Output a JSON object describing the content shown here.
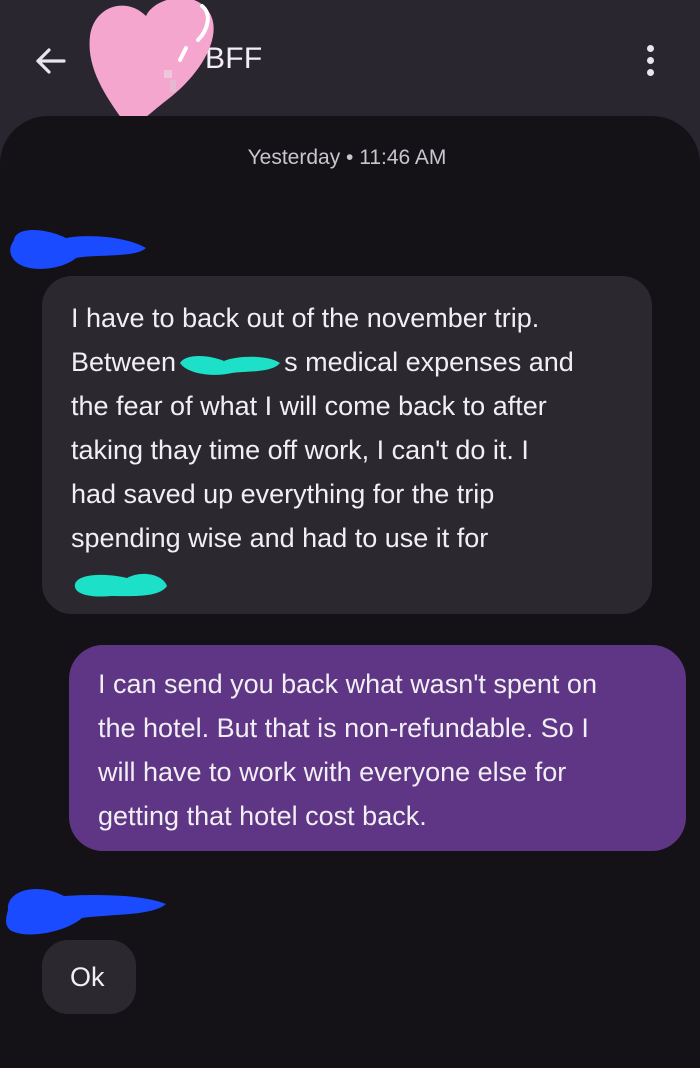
{
  "header": {
    "back_icon": "arrow-left-icon",
    "contact_name": "BFF",
    "menu_icon": "more-vert-icon"
  },
  "conversation": {
    "timestamp": "Yesterday • 11:46 AM",
    "messages": [
      {
        "direction": "incoming",
        "lines": [
          "I have to back out of the november trip.",
          "Between",
          "s medical expenses and",
          "the fear of what I will come back to after",
          "taking thay time off work, I can't do it. I",
          "had saved up everything for the trip",
          "spending wise and had to use it for"
        ]
      },
      {
        "direction": "outgoing",
        "lines": [
          "I can send you back what wasn't spent on",
          "the hotel. But that is non-refundable. So I",
          "will have to work with everyone else for",
          "getting that hotel cost back."
        ]
      },
      {
        "direction": "incoming",
        "lines": [
          "Ok"
        ]
      }
    ]
  },
  "colors": {
    "header_bg": "#2a2630",
    "conversation_bg": "#141217",
    "incoming_bubble": "#2b292f",
    "outgoing_bubble": "#5f3585",
    "heart_sticker": "#f4a6cf",
    "redaction_blue": "#1a4bff",
    "redaction_teal": "#1de0c8"
  }
}
